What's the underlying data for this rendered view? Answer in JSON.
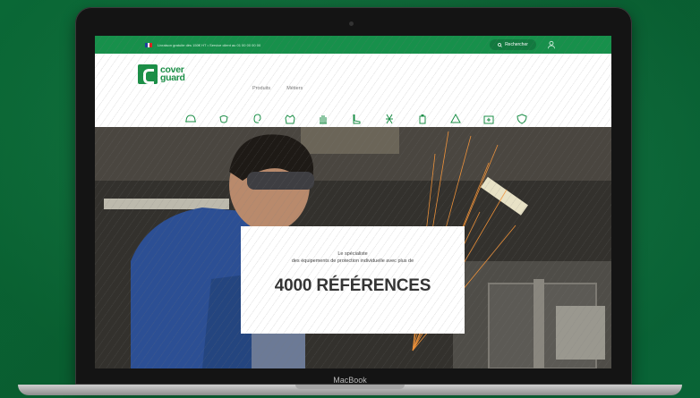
{
  "colors": {
    "brand_green": "#1b8f47",
    "topbar_green": "#17904b",
    "background_green": "#0b7540"
  },
  "topbar": {
    "message": "Livraison gratuite dès 150€ HT • Service client au 01 00 00 00 00",
    "search_label": "Rechercher"
  },
  "logo": {
    "line1": "cover",
    "line2": "guard"
  },
  "nav": {
    "items": [
      "Produits",
      "Métiers"
    ]
  },
  "categories": [
    {
      "label": "Tête & visage",
      "icon": "helmet-icon"
    },
    {
      "label": "Respiratoire",
      "icon": "mask-icon"
    },
    {
      "label": "Auditive",
      "icon": "ear-icon"
    },
    {
      "label": "Vêtements",
      "icon": "jacket-icon"
    },
    {
      "label": "Mains",
      "icon": "glove-icon"
    },
    {
      "label": "Pieds",
      "icon": "boot-icon"
    },
    {
      "label": "Antichute",
      "icon": "harness-icon"
    },
    {
      "label": "Hygiène",
      "icon": "bottle-icon"
    },
    {
      "label": "Signalisation",
      "icon": "sign-icon"
    },
    {
      "label": "Premiers secours",
      "icon": "kit-icon"
    },
    {
      "label": "Sécurité",
      "icon": "shield-icon"
    }
  ],
  "hero": {
    "line1": "Le spécialiste",
    "line2": "des équipements de protection individuelle avec plus de",
    "headline": "4000 RÉFÉRENCES"
  },
  "device": {
    "label": "MacBook"
  }
}
